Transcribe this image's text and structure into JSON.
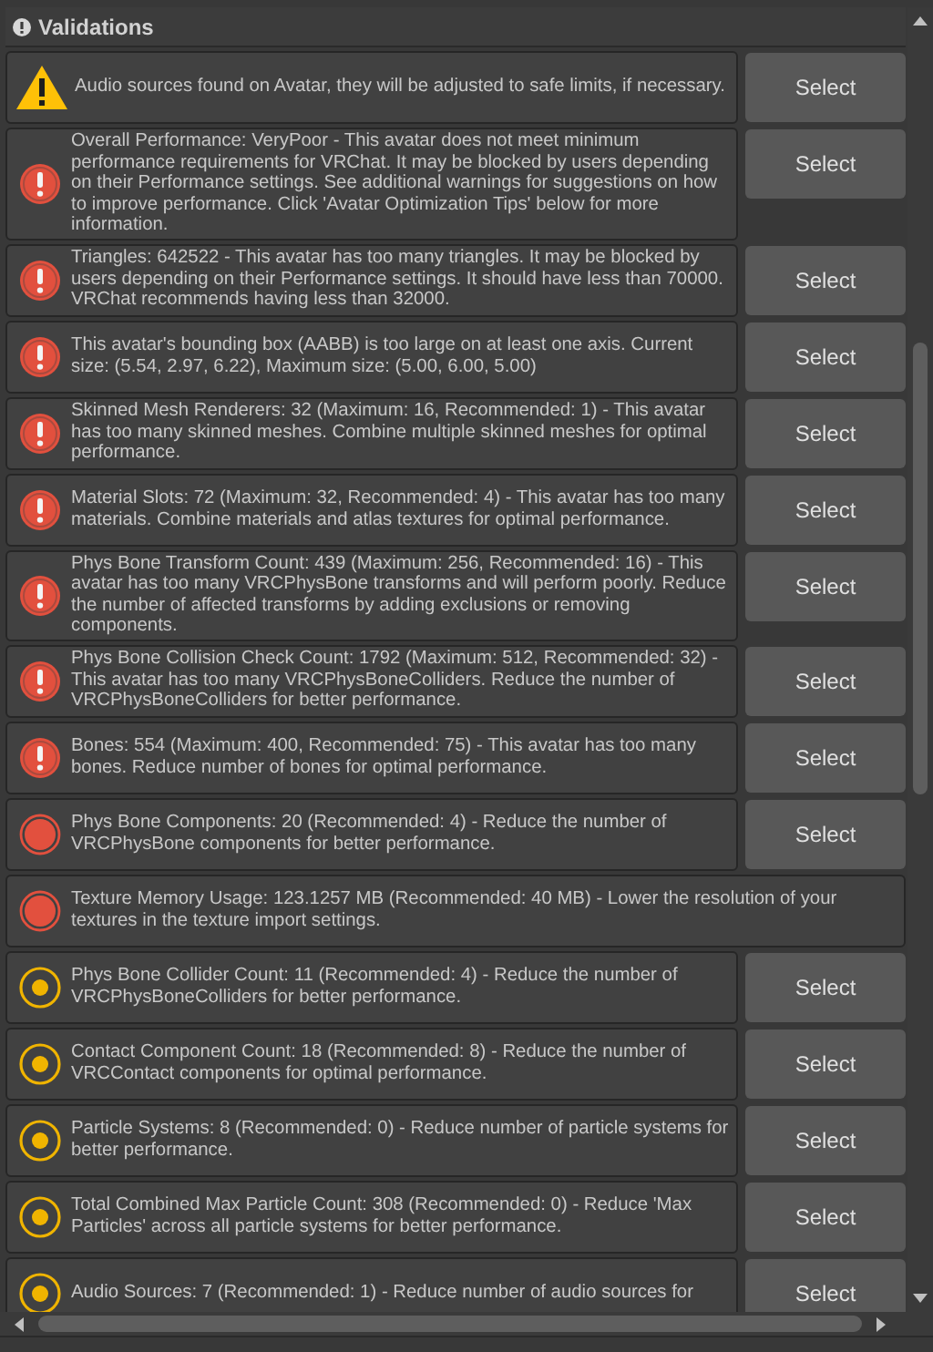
{
  "panel": {
    "title": "Validations"
  },
  "items": [
    {
      "kind": "warning",
      "message": "Audio sources found on Avatar, they will be adjusted to safe limits, if necessary.",
      "button": "Select"
    },
    {
      "kind": "error",
      "message": "Overall Performance: VeryPoor - This avatar does not meet minimum performance requirements for VRChat. It may be blocked by users depending on their Performance settings. See additional warnings for suggestions on how to improve performance. Click 'Avatar Optimization Tips' below for more information.",
      "button": "Select"
    },
    {
      "kind": "error",
      "message": "Triangles: 642522 - This avatar has too many triangles. It may be blocked by users depending on their Performance settings. It should have less than 70000. VRChat recommends having less than 32000.",
      "button": "Select"
    },
    {
      "kind": "error",
      "message": "This avatar's bounding box (AABB) is too large on at least one axis. Current size: (5.54, 2.97, 6.22), Maximum size: (5.00, 6.00, 5.00)",
      "button": "Select"
    },
    {
      "kind": "error",
      "message": "Skinned Mesh Renderers: 32 (Maximum: 16, Recommended: 1) - This avatar has too many skinned meshes. Combine multiple skinned meshes for optimal performance.",
      "button": "Select"
    },
    {
      "kind": "error",
      "message": "Material Slots: 72 (Maximum: 32, Recommended: 4) - This avatar has too many materials. Combine materials and atlas textures for optimal performance.",
      "button": "Select"
    },
    {
      "kind": "error",
      "message": "Phys Bone Transform Count: 439 (Maximum: 256, Recommended: 16) - This avatar has too many VRCPhysBone transforms and will perform poorly. Reduce the number of affected transforms by adding exclusions or removing components.",
      "button": "Select"
    },
    {
      "kind": "error",
      "message": "Phys Bone Collision Check Count: 1792 (Maximum: 512, Recommended: 32) - This avatar has too many VRCPhysBoneColliders. Reduce the number of VRCPhysBoneColliders for better performance.",
      "button": "Select"
    },
    {
      "kind": "error",
      "message": "Bones: 554 (Maximum: 400, Recommended: 75) - This avatar has too many bones. Reduce number of bones for optimal performance.",
      "button": "Select"
    },
    {
      "kind": "error_dot",
      "message": "Phys Bone Components: 20 (Recommended: 4) - Reduce the number of VRCPhysBone components for better performance.",
      "button": "Select"
    },
    {
      "kind": "error_dot",
      "message": "Texture Memory Usage: 123.1257 MB (Recommended: 40 MB) - Lower the resolution of your textures in the texture import settings."
    },
    {
      "kind": "caution",
      "message": "Phys Bone Collider Count: 11 (Recommended: 4) - Reduce the number of VRCPhysBoneColliders for better performance.",
      "button": "Select"
    },
    {
      "kind": "caution",
      "message": "Contact Component Count: 18 (Recommended: 8) - Reduce the number of VRCContact components for optimal performance.",
      "button": "Select"
    },
    {
      "kind": "caution",
      "message": "Particle Systems: 8 (Recommended: 0) - Reduce number of particle systems for better performance.",
      "button": "Select"
    },
    {
      "kind": "caution",
      "message": "Total Combined Max Particle Count: 308 (Recommended: 0) - Reduce 'Max Particles' across all particle systems for better performance.",
      "button": "Select"
    },
    {
      "kind": "caution",
      "message": "Audio Sources: 7 (Recommended: 1) - Reduce number of audio sources for",
      "button": "Select"
    }
  ]
}
